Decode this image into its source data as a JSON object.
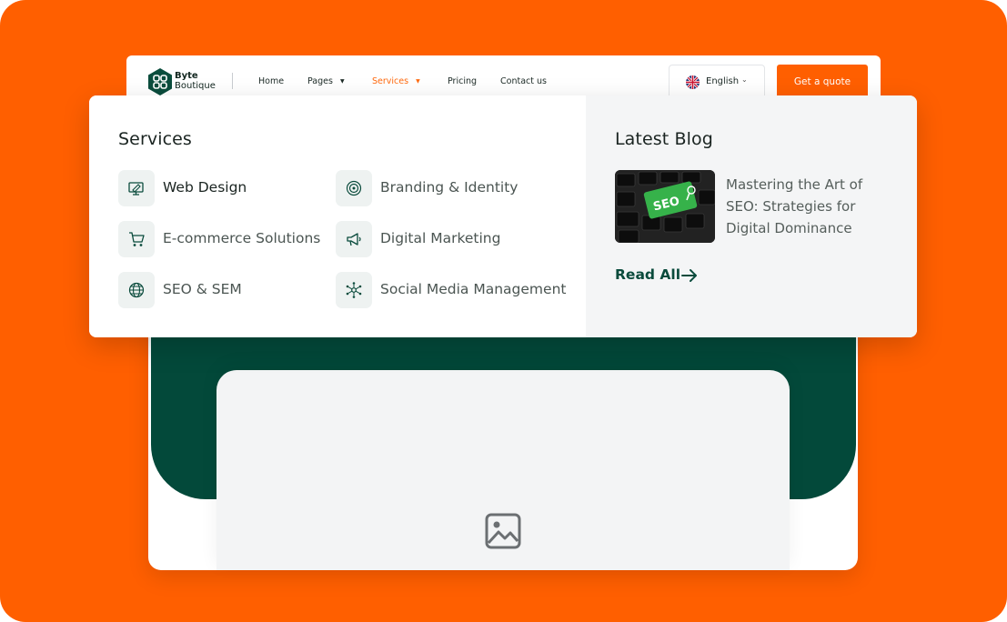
{
  "brand": {
    "line1": "Byte",
    "line2": "Boutique"
  },
  "nav": {
    "home": "Home",
    "pages": "Pages",
    "services": "Services",
    "pricing": "Pricing",
    "contact": "Contact us"
  },
  "language": {
    "selected": "English"
  },
  "cta": {
    "label": "Get a quote"
  },
  "mega_menu": {
    "services_title": "Services",
    "services": [
      {
        "label": "Web Design",
        "icon": "web-design-icon"
      },
      {
        "label": "Branding & Identity",
        "icon": "branding-icon"
      },
      {
        "label": "E-commerce Solutions",
        "icon": "cart-icon"
      },
      {
        "label": "Digital Marketing",
        "icon": "megaphone-icon"
      },
      {
        "label": "SEO & SEM",
        "icon": "globe-icon"
      },
      {
        "label": "Social Media Management",
        "icon": "network-icon"
      }
    ],
    "blog_title": "Latest Blog",
    "blog_post": {
      "title": "Mastering the Art of SEO: Strategies for Digital Dominance",
      "thumb_text": "SEO"
    },
    "read_all": "Read All"
  },
  "colors": {
    "accent": "#ff5f00",
    "brand_green": "#03493a",
    "active_nav": "#ff6a0f"
  }
}
